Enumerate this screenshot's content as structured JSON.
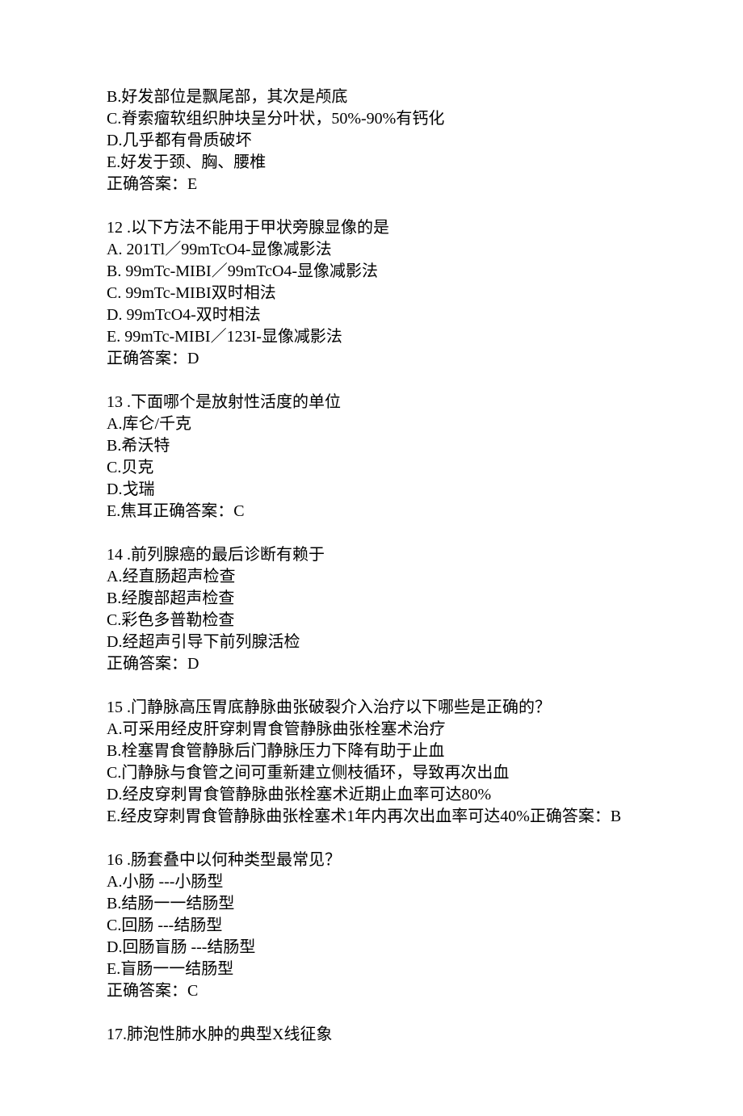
{
  "blocks": [
    {
      "lines": [
        "B.好发部位是飘尾部，其次是颅底",
        "C.脊索瘤软组织肿块呈分叶状，50%-90%有钙化",
        "D.几乎都有骨质破坏",
        "E.好发于颈、胸、腰椎",
        "正确答案：E"
      ]
    },
    {
      "lines": [
        "12 .以下方法不能用于甲状旁腺显像的是",
        "A. 201Tl／99mTcO4-显像减影法",
        "B. 99mTc-MIBI／99mTcO4-显像减影法",
        "C. 99mTc-MIBI双时相法",
        "D. 99mTcO4-双时相法",
        "E. 99mTc-MIBI／123I-显像减影法",
        "正确答案：D"
      ]
    },
    {
      "lines": [
        "13 .下面哪个是放射性活度的单位",
        "A.库仑/千克",
        "B.希沃特",
        "C.贝克",
        "D.戈瑞",
        "E.焦耳正确答案：C"
      ]
    },
    {
      "lines": [
        "14 .前列腺癌的最后诊断有赖于",
        "A.经直肠超声检查",
        "B.经腹部超声检查",
        "C.彩色多普勒检查",
        "D.经超声引导下前列腺活检",
        "正确答案：D"
      ]
    },
    {
      "lines": [
        "15 .门静脉高压胃底静脉曲张破裂介入治疗以下哪些是正确的？",
        "A.可采用经皮肝穿刺胃食管静脉曲张栓塞术治疗",
        "B.栓塞胃食管静脉后门静脉压力下降有助于止血",
        "C.门静脉与食管之间可重新建立侧枝循环，导致再次出血",
        "D.经皮穿刺胃食管静脉曲张栓塞术近期止血率可达80%",
        "E.经皮穿刺胃食管静脉曲张栓塞术1年内再次出血率可达40%正确答案：B"
      ]
    },
    {
      "lines": [
        "16 .肠套叠中以何种类型最常见？",
        "A.小肠 ---小肠型",
        "B.结肠一一结肠型",
        "C.回肠 ---结肠型",
        "D.回肠盲肠 ---结肠型",
        "E.盲肠一一结肠型",
        "正确答案：C"
      ]
    },
    {
      "lines": [
        "17.肺泡性肺水肿的典型X线征象"
      ]
    }
  ]
}
